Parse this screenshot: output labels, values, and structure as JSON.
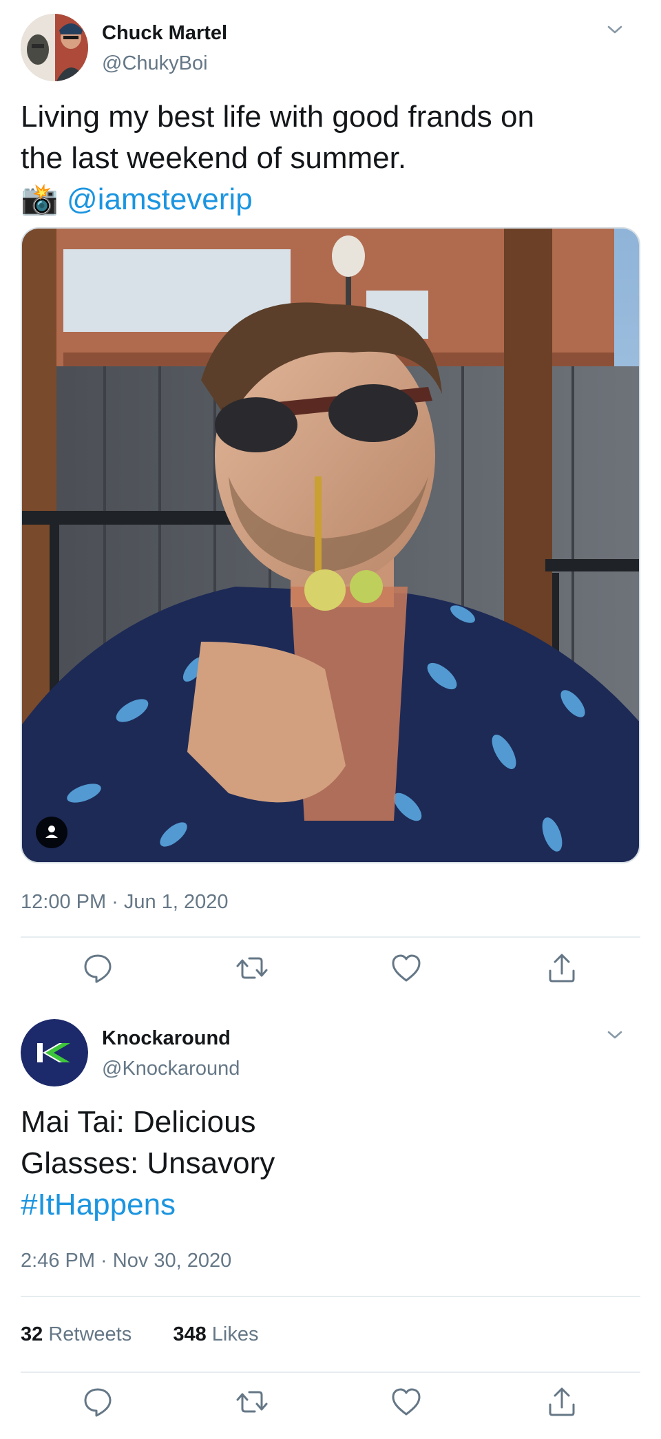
{
  "tweets": [
    {
      "author": {
        "name": "Chuck Martel",
        "handle": "@ChukyBoi"
      },
      "text_lines": [
        "Living my best life with good frands on",
        "the last weekend of summer."
      ],
      "mention_prefix": "📸",
      "mention": "@iamsteverip",
      "timestamp": "12:00 PM · Jun 1, 2020",
      "media": {
        "type": "photo",
        "description_icon": "person-tag-icon"
      }
    },
    {
      "author": {
        "name": "Knockaround",
        "handle": "@Knockaround",
        "logo_letter": "K"
      },
      "text_lines": [
        "Mai Tai: Delicious",
        "Glasses: Unsavory"
      ],
      "hashtag": "#ItHappens",
      "timestamp": "2:46 PM · Nov 30, 2020",
      "stats": {
        "retweets_count": "32",
        "retweets_label": "Retweets",
        "likes_count": "348",
        "likes_label": "Likes"
      }
    }
  ],
  "actions": [
    "reply-icon",
    "retweet-icon",
    "like-icon",
    "share-icon"
  ],
  "colors": {
    "link": "#1b95e0",
    "secondary_text": "#657786",
    "divider": "#e6ecf0",
    "brand_navy": "#1c2a6b",
    "brand_green": "#3ec63b"
  }
}
